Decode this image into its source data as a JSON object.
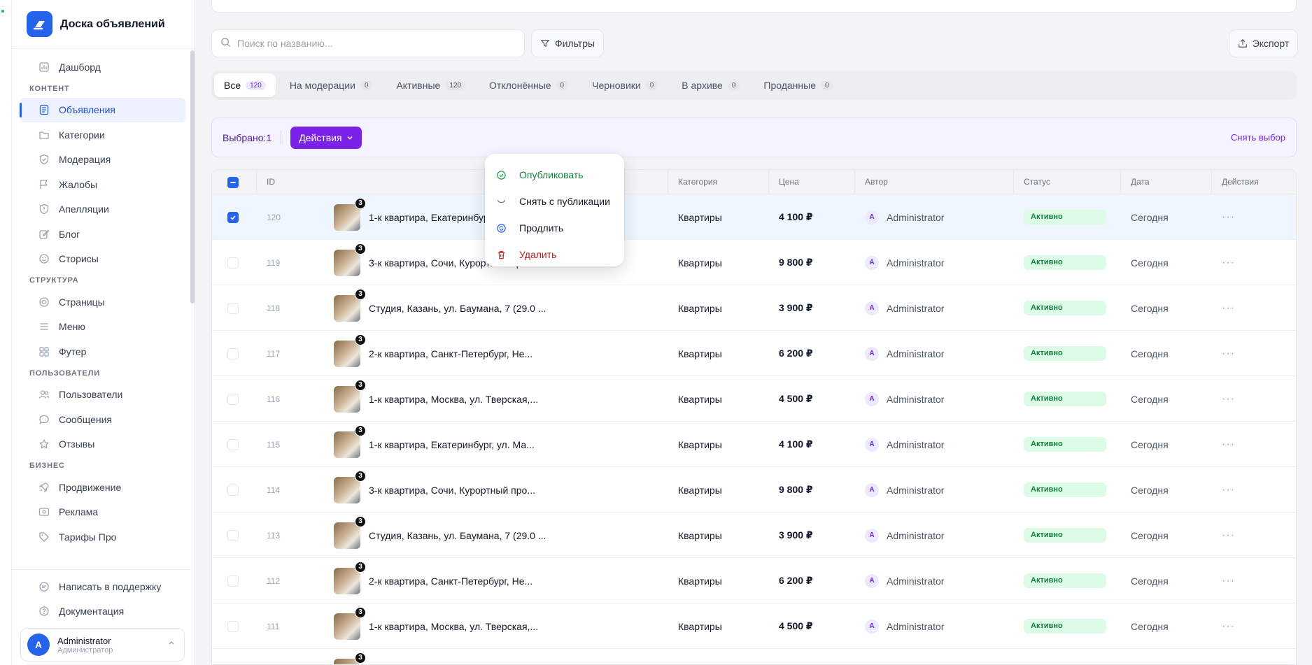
{
  "app": {
    "title": "Доска объявлений"
  },
  "sidebar": {
    "top_items": [
      {
        "label": "Дашборд",
        "icon": "dashboard-icon"
      }
    ],
    "sections": [
      {
        "label": "КОНТЕНТ",
        "items": [
          {
            "label": "Объявления",
            "icon": "document-icon",
            "active": true
          },
          {
            "label": "Категории",
            "icon": "folder-icon"
          },
          {
            "label": "Модерация",
            "icon": "shield-check-icon"
          },
          {
            "label": "Жалобы",
            "icon": "flag-icon"
          },
          {
            "label": "Апелляции",
            "icon": "shield-alert-icon"
          },
          {
            "label": "Блог",
            "icon": "pencil-square-icon"
          },
          {
            "label": "Сторисы",
            "icon": "smile-icon"
          }
        ]
      },
      {
        "label": "СТРУКТУРА",
        "items": [
          {
            "label": "Страницы",
            "icon": "page-icon"
          },
          {
            "label": "Меню",
            "icon": "menu-icon"
          },
          {
            "label": "Футер",
            "icon": "grid-icon"
          }
        ]
      },
      {
        "label": "ПОЛЬЗОВАТЕЛИ",
        "items": [
          {
            "label": "Пользователи",
            "icon": "users-icon"
          },
          {
            "label": "Сообщения",
            "icon": "chat-icon"
          },
          {
            "label": "Отзывы",
            "icon": "star-icon"
          }
        ]
      },
      {
        "label": "БИЗНЕС",
        "items": [
          {
            "label": "Продвижение",
            "icon": "rocket-icon"
          },
          {
            "label": "Реклама",
            "icon": "ad-icon"
          },
          {
            "label": "Тарифы Про",
            "icon": "tag-icon"
          }
        ]
      }
    ],
    "bottom_items": [
      {
        "label": "Написать в поддержку",
        "icon": "message-icon"
      },
      {
        "label": "Документация",
        "icon": "help-icon"
      }
    ],
    "user": {
      "initial": "A",
      "name": "Administrator",
      "role": "Администратор"
    }
  },
  "toolbar": {
    "search_placeholder": "Поиск по названию...",
    "filters_label": "Фильтры",
    "export_label": "Экспорт"
  },
  "tabs": [
    {
      "label": "Все",
      "count": "120",
      "active": true
    },
    {
      "label": "На модерации",
      "count": "0"
    },
    {
      "label": "Активные",
      "count": "120"
    },
    {
      "label": "Отклонённые",
      "count": "0"
    },
    {
      "label": "Черновики",
      "count": "0"
    },
    {
      "label": "В архиве",
      "count": "0"
    },
    {
      "label": "Проданные",
      "count": "0"
    }
  ],
  "selection": {
    "selected_text": "Выбрано:1",
    "actions_label": "Действия",
    "clear_label": "Снять выбор"
  },
  "dropdown": [
    {
      "label": "Опубликовать",
      "icon": "check-circle-icon",
      "tone": "green"
    },
    {
      "label": "Снять с публикации",
      "icon": "unpublish-icon",
      "tone": "default"
    },
    {
      "label": "Продлить",
      "icon": "refresh-icon",
      "tone": "default"
    },
    {
      "label": "Удалить",
      "icon": "trash-icon",
      "tone": "red"
    }
  ],
  "table": {
    "columns": [
      "ID",
      "Категория",
      "Цена",
      "Автор",
      "Статус",
      "Дата",
      "Действия"
    ],
    "rows": [
      {
        "id": "120",
        "title": "1-к квартира, Екатеринбург, ул. Ма...",
        "photos": "3",
        "category": "Квартиры",
        "price": "4 100 ₽",
        "author_initial": "A",
        "author": "Administrator",
        "status": "Активно",
        "date": "Сегодня",
        "selected": true
      },
      {
        "id": "119",
        "title": "3-к квартира, Сочи, Курортный про...",
        "photos": "3",
        "category": "Квартиры",
        "price": "9 800 ₽",
        "author_initial": "A",
        "author": "Administrator",
        "status": "Активно",
        "date": "Сегодня"
      },
      {
        "id": "118",
        "title": "Студия, Казань, ул. Баумана, 7 (29.0 ...",
        "photos": "3",
        "category": "Квартиры",
        "price": "3 900 ₽",
        "author_initial": "A",
        "author": "Administrator",
        "status": "Активно",
        "date": "Сегодня"
      },
      {
        "id": "117",
        "title": "2-к квартира, Санкт-Петербург, Не...",
        "photos": "3",
        "category": "Квартиры",
        "price": "6 200 ₽",
        "author_initial": "A",
        "author": "Administrator",
        "status": "Активно",
        "date": "Сегодня"
      },
      {
        "id": "116",
        "title": "1-к квартира, Москва, ул. Тверская,...",
        "photos": "3",
        "category": "Квартиры",
        "price": "4 500 ₽",
        "author_initial": "A",
        "author": "Administrator",
        "status": "Активно",
        "date": "Сегодня"
      },
      {
        "id": "115",
        "title": "1-к квартира, Екатеринбург, ул. Ма...",
        "photos": "3",
        "category": "Квартиры",
        "price": "4 100 ₽",
        "author_initial": "A",
        "author": "Administrator",
        "status": "Активно",
        "date": "Сегодня"
      },
      {
        "id": "114",
        "title": "3-к квартира, Сочи, Курортный про...",
        "photos": "3",
        "category": "Квартиры",
        "price": "9 800 ₽",
        "author_initial": "A",
        "author": "Administrator",
        "status": "Активно",
        "date": "Сегодня"
      },
      {
        "id": "113",
        "title": "Студия, Казань, ул. Баумана, 7 (29.0 ...",
        "photos": "3",
        "category": "Квартиры",
        "price": "3 900 ₽",
        "author_initial": "A",
        "author": "Administrator",
        "status": "Активно",
        "date": "Сегодня"
      },
      {
        "id": "112",
        "title": "2-к квартира, Санкт-Петербург, Не...",
        "photos": "3",
        "category": "Квартиры",
        "price": "6 200 ₽",
        "author_initial": "A",
        "author": "Administrator",
        "status": "Активно",
        "date": "Сегодня"
      },
      {
        "id": "111",
        "title": "1-к квартира, Москва, ул. Тверская,...",
        "photos": "3",
        "category": "Квартиры",
        "price": "4 500 ₽",
        "author_initial": "A",
        "author": "Administrator",
        "status": "Активно",
        "date": "Сегодня"
      },
      {
        "id": "",
        "title": "",
        "photos": "3",
        "category": "",
        "price": "",
        "author_initial": "",
        "author": "",
        "status": "",
        "date": ""
      }
    ]
  },
  "colors": {
    "accent": "#2563eb",
    "actions": "#7c22e8",
    "status_bg": "#dcfce7",
    "status_text": "#15803d"
  }
}
